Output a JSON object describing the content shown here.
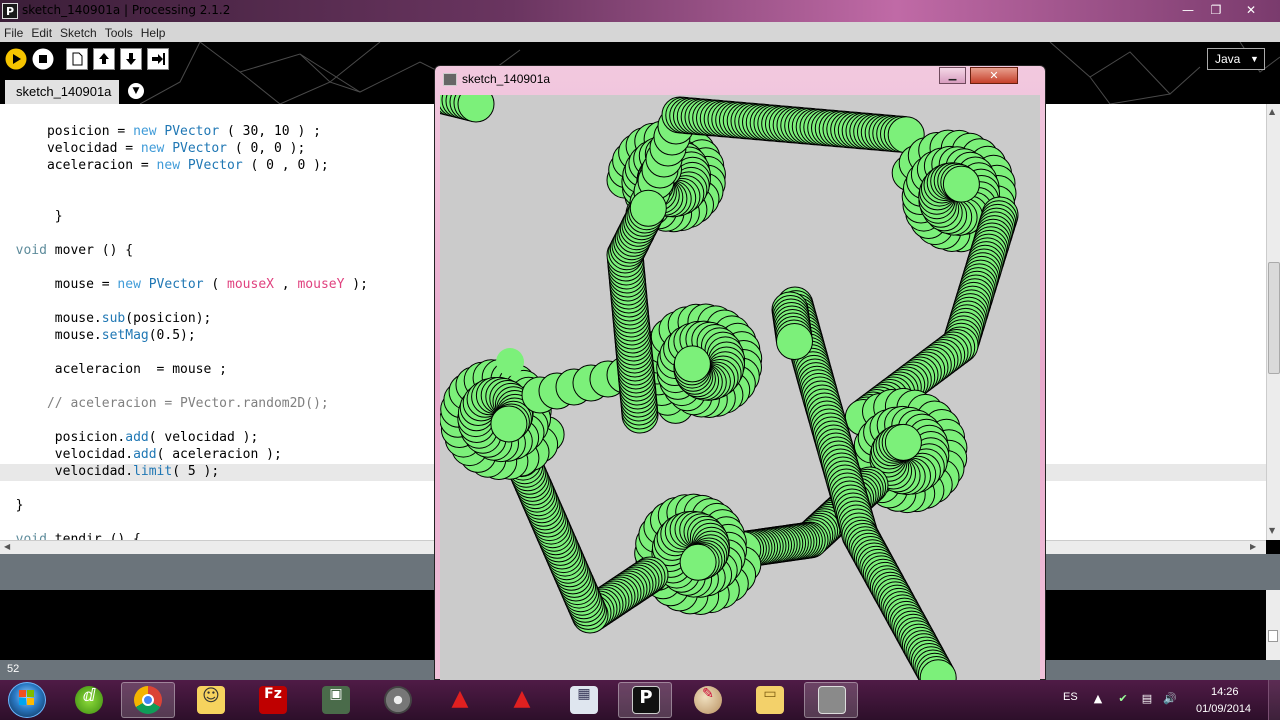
{
  "window": {
    "title": "sketch_140901a | Processing 2.1.2",
    "icon": "P",
    "controls": {
      "minimize": "—",
      "maximize": "❐",
      "close": "✕"
    }
  },
  "menu": [
    "File",
    "Edit",
    "Sketch",
    "Tools",
    "Help"
  ],
  "toolbar": {
    "run": "run-icon",
    "stop": "stop-icon",
    "new": "new-icon",
    "open": "open-icon",
    "save": "save-icon",
    "export": "export-icon"
  },
  "mode": {
    "label": "Java",
    "arrow": "▼"
  },
  "tabs": [
    {
      "label": "sketch_140901a"
    }
  ],
  "tab_menu_arrow": "▼",
  "code": {
    "l1": [
      "posicion = ",
      "new",
      " ",
      "PVector",
      " ( 30, 10 ) ;"
    ],
    "l2": [
      "velocidad = ",
      "new",
      " ",
      "PVector",
      " ( 0, 0 );"
    ],
    "l3": [
      "aceleracion = ",
      "new",
      " ",
      "PVector",
      " ( 0 , 0 );"
    ],
    "l4": "}",
    "l5": [
      "void",
      " mover () {"
    ],
    "l6": [
      "mouse = ",
      "new",
      " ",
      "PVector",
      " ( ",
      "mouseX",
      " , ",
      "mouseY",
      " );"
    ],
    "l7": [
      "mouse.",
      "sub",
      "(posicion);"
    ],
    "l8": [
      "mouse.",
      "setMag",
      "(0.5);"
    ],
    "l9": "aceleracion  = mouse ;",
    "l10": "// aceleracion = PVector.random2D();",
    "l11": [
      "posicion.",
      "add",
      "( velocidad );"
    ],
    "l12": [
      "velocidad.",
      "add",
      "( aceleracion );"
    ],
    "l13": [
      "velocidad.",
      "limit",
      "( 5 );"
    ],
    "l14": "}",
    "l15": [
      "void",
      " tendir () {"
    ]
  },
  "console": {
    "line_number": "52"
  },
  "sketch_window": {
    "title": "sketch_140901a",
    "controls": {
      "minimize": "▁",
      "maximize": "▢",
      "close": "✕"
    },
    "colors": {
      "background": "#cbcbcb",
      "circle_fill": "#7cf07a",
      "circle_stroke": "#000000"
    }
  },
  "taskbar": {
    "apps": [
      {
        "name": "start-orb"
      },
      {
        "name": "media-player-icon"
      },
      {
        "name": "chrome-icon"
      },
      {
        "name": "explorer-icon"
      },
      {
        "name": "filezilla-icon"
      },
      {
        "name": "monitor-icon"
      },
      {
        "name": "disc-icon"
      },
      {
        "name": "autocad-icon"
      },
      {
        "name": "autocad-icon"
      },
      {
        "name": "calculator-icon"
      },
      {
        "name": "processing-icon"
      },
      {
        "name": "paint-icon"
      },
      {
        "name": "folder-icon"
      },
      {
        "name": "sketch-icon"
      }
    ],
    "glyphs": {
      "filezilla": "Fz",
      "processing": "P"
    },
    "language": "ES",
    "time": "14:26",
    "date": "01/09/2014"
  }
}
